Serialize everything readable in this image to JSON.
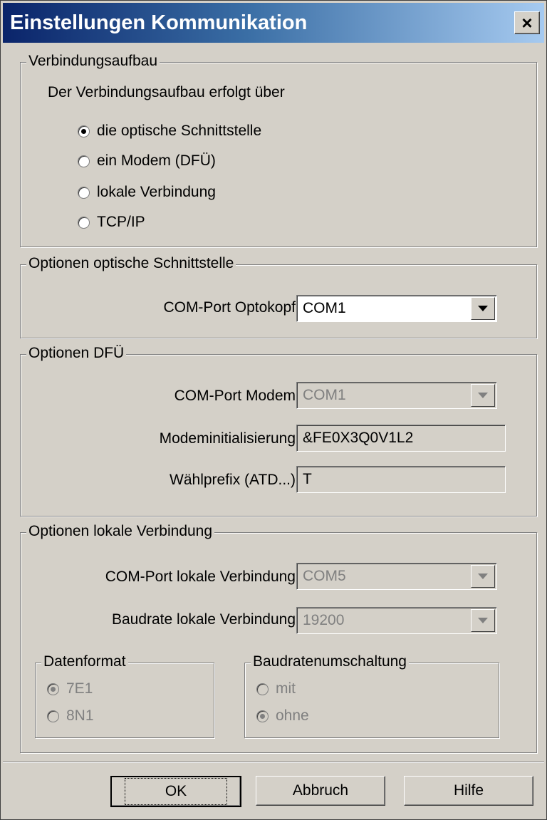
{
  "window": {
    "title": "Einstellungen Kommunikation",
    "close_label": "×"
  },
  "verbindung": {
    "legend": "Verbindungsaufbau",
    "prompt": "Der Verbindungsaufbau erfolgt über",
    "options": [
      {
        "label": "die optische Schnittstelle",
        "checked": true
      },
      {
        "label": "ein Modem (DFÜ)",
        "checked": false
      },
      {
        "label": "lokale Verbindung",
        "checked": false
      },
      {
        "label": "TCP/IP",
        "checked": false
      }
    ]
  },
  "optisch": {
    "legend": "Optionen optische Schnittstelle",
    "com_label": "COM-Port Optokopf",
    "com_value": "COM1"
  },
  "dfue": {
    "legend": "Optionen DFÜ",
    "com_label": "COM-Port Modem",
    "com_value": "COM1",
    "init_label": "Modeminitialisierung",
    "init_value": "&FE0X3Q0V1L2",
    "prefix_label": "Wählprefix (ATD...)",
    "prefix_value": "T"
  },
  "lokal": {
    "legend": "Optionen lokale Verbindung",
    "com_label": "COM-Port lokale Verbindung",
    "com_value": "COM5",
    "baud_label": "Baudrate lokale Verbindung",
    "baud_value": "19200",
    "datenformat": {
      "legend": "Datenformat",
      "options": [
        {
          "label": "7E1",
          "checked": true
        },
        {
          "label": "8N1",
          "checked": false
        }
      ]
    },
    "baudumschaltung": {
      "legend": "Baudratenumschaltung",
      "options": [
        {
          "label": "mit",
          "checked": false
        },
        {
          "label": "ohne",
          "checked": true
        }
      ]
    }
  },
  "buttons": {
    "ok": "OK",
    "cancel": "Abbruch",
    "help": "Hilfe"
  }
}
